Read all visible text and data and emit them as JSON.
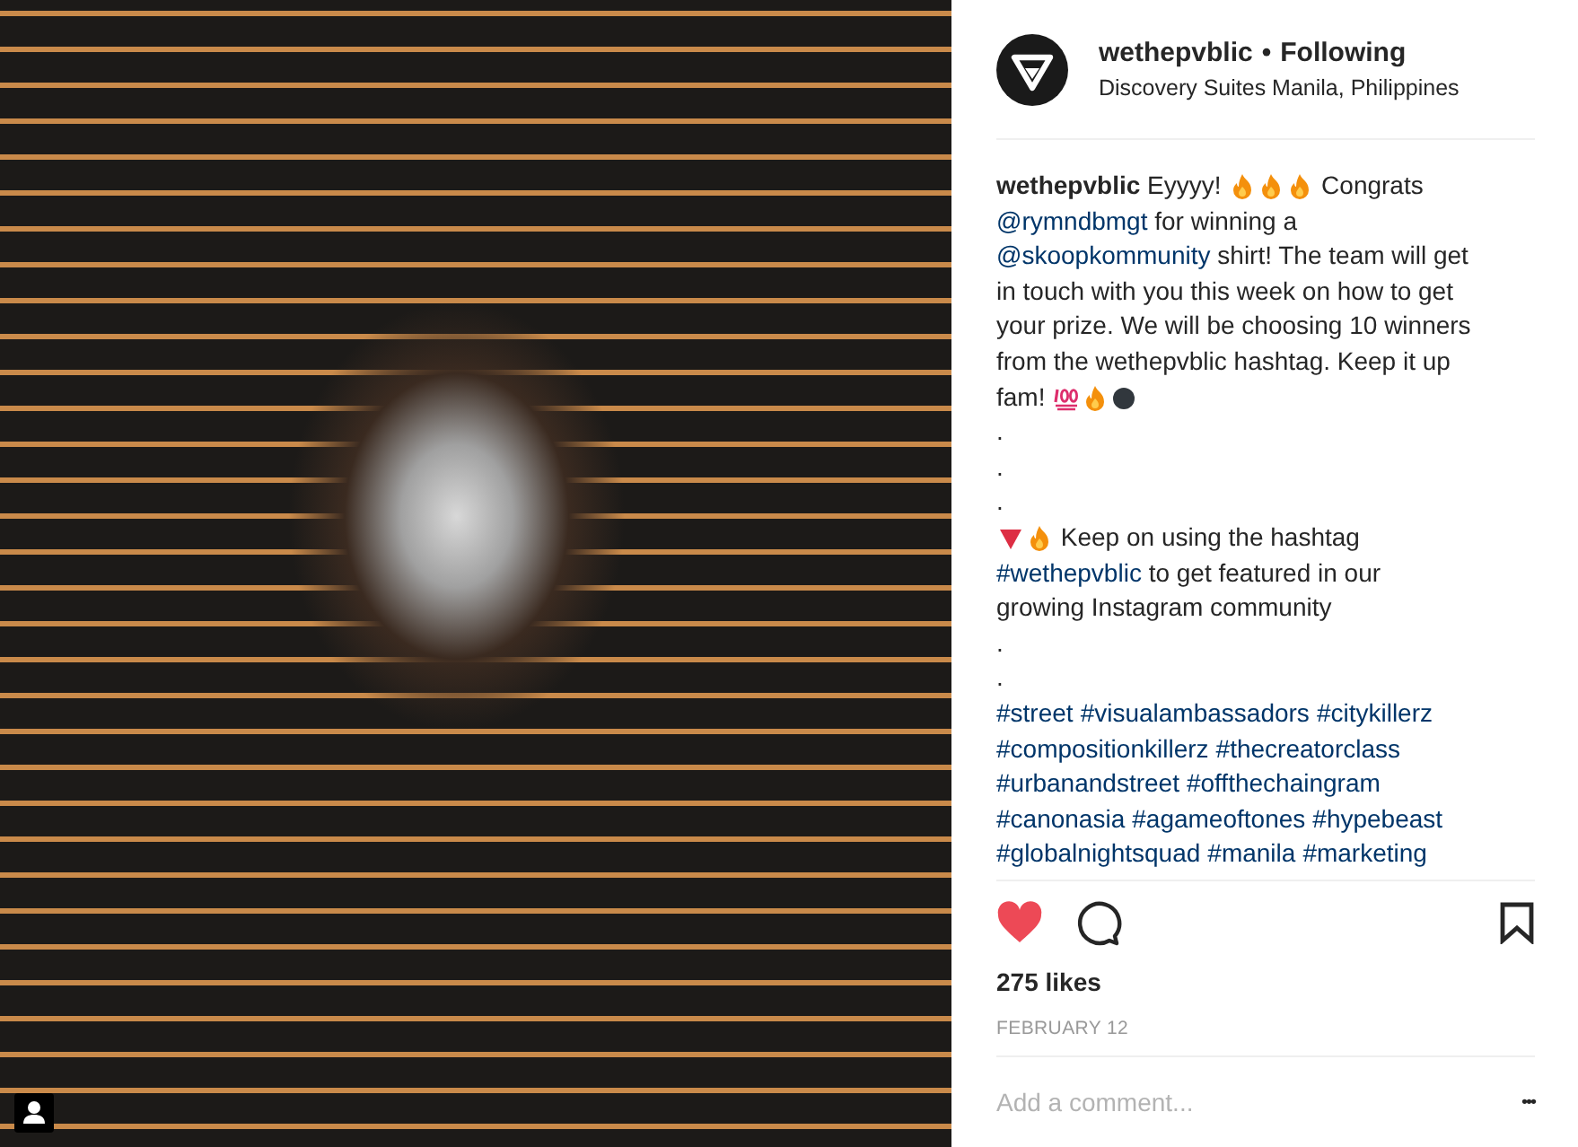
{
  "photo": {
    "user_tags": true
  },
  "header": {
    "username": "wethepvblic",
    "separator": "•",
    "follow": "Following",
    "location": "Discovery Suites Manila, Philippines"
  },
  "caption": {
    "lines": [
      [
        {
          "kind": "author",
          "text": "wethepvblic"
        },
        {
          "kind": "text",
          "text": " Eyyyy! "
        },
        {
          "kind": "flame"
        },
        {
          "kind": "flame"
        },
        {
          "kind": "flame"
        },
        {
          "kind": "text",
          "text": " Congrats"
        }
      ],
      [
        {
          "kind": "link",
          "text": "@rymndbmgt"
        },
        {
          "kind": "text",
          "text": " for winning a"
        }
      ],
      [
        {
          "kind": "link",
          "text": "@skoopkommunity"
        },
        {
          "kind": "text",
          "text": " shirt! The team will get"
        }
      ],
      [
        {
          "kind": "text",
          "text": "in touch with you this week on how to get"
        }
      ],
      [
        {
          "kind": "text",
          "text": "your prize. We will be choosing 10 winners"
        }
      ],
      [
        {
          "kind": "text",
          "text": "from the wethepvblic hashtag. Keep it up"
        }
      ],
      [
        {
          "kind": "text",
          "text": "fam! "
        },
        {
          "kind": "hundred"
        },
        {
          "kind": "flame"
        },
        {
          "kind": "dot"
        }
      ],
      [
        {
          "kind": "text",
          "text": "."
        }
      ],
      [
        {
          "kind": "text",
          "text": "."
        }
      ],
      [
        {
          "kind": "text",
          "text": "."
        }
      ],
      [
        {
          "kind": "triangle"
        },
        {
          "kind": "flame"
        },
        {
          "kind": "text",
          "text": " Keep on using the hashtag"
        }
      ],
      [
        {
          "kind": "link",
          "text": "#wethepvblic"
        },
        {
          "kind": "text",
          "text": " to get featured in our"
        }
      ],
      [
        {
          "kind": "text",
          "text": "growing Instagram community"
        }
      ],
      [
        {
          "kind": "text",
          "text": "."
        }
      ],
      [
        {
          "kind": "text",
          "text": "."
        }
      ],
      [
        {
          "kind": "link",
          "text": "#street"
        },
        {
          "kind": "link",
          "text": "#visualambassadors"
        },
        {
          "kind": "link",
          "text": "#citykillerz"
        }
      ],
      [
        {
          "kind": "link",
          "text": "#compositionkillerz"
        },
        {
          "kind": "link",
          "text": "#thecreatorclass"
        }
      ],
      [
        {
          "kind": "link",
          "text": "#urbanandstreet"
        },
        {
          "kind": "link",
          "text": "#offthechaingram"
        }
      ],
      [
        {
          "kind": "link",
          "text": "#canonasia"
        },
        {
          "kind": "link",
          "text": "#agameoftones"
        },
        {
          "kind": "link",
          "text": "#hypebeast"
        }
      ],
      [
        {
          "kind": "link",
          "text": "#globalnightsquad"
        },
        {
          "kind": "link",
          "text": "#manila"
        },
        {
          "kind": "link",
          "text": "#marketing"
        }
      ]
    ]
  },
  "actions": {
    "liked": true,
    "saved": false
  },
  "likes": "275 likes",
  "date": "FEBRUARY 12",
  "comment": {
    "placeholder": "Add a comment...",
    "more": "•••"
  }
}
